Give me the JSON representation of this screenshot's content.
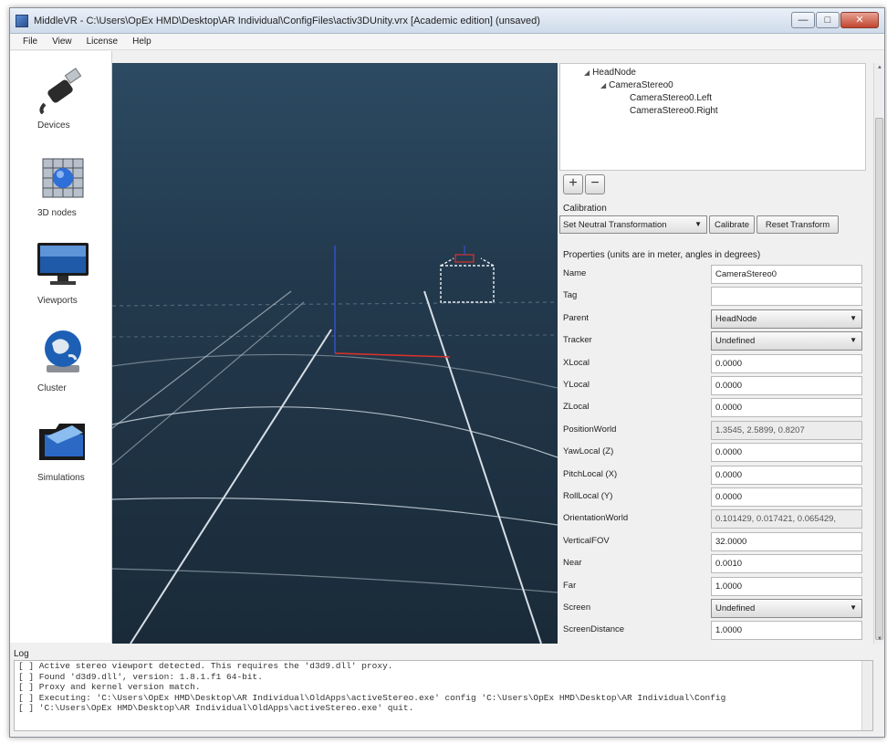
{
  "window": {
    "title": "MiddleVR - C:\\Users\\OpEx HMD\\Desktop\\AR Individual\\ConfigFiles\\activ3DUnity.vrx [Academic edition] (unsaved)",
    "minimize_glyph": "—",
    "maximize_glyph": "□",
    "close_glyph": "✕"
  },
  "menu": [
    "File",
    "View",
    "License",
    "Help"
  ],
  "sidebar": {
    "items": [
      {
        "label": "Devices",
        "icon": "usb-plug-icon"
      },
      {
        "label": "3D nodes",
        "icon": "cube-node-icon"
      },
      {
        "label": "Viewports",
        "icon": "monitor-icon"
      },
      {
        "label": "Cluster",
        "icon": "globe-icon"
      },
      {
        "label": "Simulations",
        "icon": "folder-icon"
      }
    ]
  },
  "tree": {
    "nodes": [
      {
        "label": "HeadNode",
        "expanded": true
      },
      {
        "label": "CameraStereo0",
        "expanded": true
      },
      {
        "label": "CameraStereo0.Left"
      },
      {
        "label": "CameraStereo0.Right"
      }
    ]
  },
  "buttons": {
    "add": "+",
    "remove": "−"
  },
  "calibration": {
    "label": "Calibration",
    "select_value": "Set Neutral Transformation",
    "calibrate_button": "Calibrate",
    "reset_button": "Reset Transform"
  },
  "properties": {
    "header": "Properties (units are in meter, angles in degrees)",
    "rows": [
      {
        "name": "Name",
        "value": "CameraStereo0",
        "kind": "text"
      },
      {
        "name": "Tag",
        "value": "",
        "kind": "text"
      },
      {
        "name": "Parent",
        "value": "HeadNode",
        "kind": "select"
      },
      {
        "name": "Tracker",
        "value": "Undefined",
        "kind": "select"
      },
      {
        "name": "XLocal",
        "value": "0.0000",
        "kind": "text"
      },
      {
        "name": "YLocal",
        "value": "0.0000",
        "kind": "text"
      },
      {
        "name": "ZLocal",
        "value": "0.0000",
        "kind": "text"
      },
      {
        "name": "PositionWorld",
        "value": "1.3545, 2.5899, 0.8207",
        "kind": "readonly"
      },
      {
        "name": "YawLocal (Z)",
        "value": "0.0000",
        "kind": "text"
      },
      {
        "name": "PitchLocal (X)",
        "value": "0.0000",
        "kind": "text"
      },
      {
        "name": "RollLocal (Y)",
        "value": "0.0000",
        "kind": "text"
      },
      {
        "name": "OrientationWorld",
        "value": "0.101429, 0.017421, 0.065429,",
        "kind": "readonly"
      },
      {
        "name": "VerticalFOV",
        "value": "32.0000",
        "kind": "text"
      },
      {
        "name": "Near",
        "value": "0.0010",
        "kind": "text"
      },
      {
        "name": "Far",
        "value": "1.0000",
        "kind": "text"
      },
      {
        "name": "Screen",
        "value": "Undefined",
        "kind": "select"
      },
      {
        "name": "ScreenDistance",
        "value": "1.0000",
        "kind": "text"
      }
    ]
  },
  "log": {
    "title": "Log",
    "lines": [
      "[ ] Active stereo viewport detected. This requires the 'd3d9.dll' proxy.",
      "[ ] Found 'd3d9.dll', version: 1.8.1.f1 64-bit.",
      "[ ] Proxy and kernel version match.",
      "[ ] Executing: 'C:\\Users\\OpEx HMD\\Desktop\\AR Individual\\OldApps\\activeStereo.exe'   config 'C:\\Users\\OpEx HMD\\Desktop\\AR Individual\\Config",
      "[ ] 'C:\\Users\\OpEx HMD\\Desktop\\AR Individual\\OldApps\\activeStereo.exe' quit."
    ]
  },
  "colors": {
    "viewport_top": "#2c4a62",
    "viewport_bottom": "#1a2a38",
    "grid": "#c9d3dc",
    "axis_x": "#d8322c",
    "axis_z": "#3550c8",
    "frustum": "#e9eef2"
  }
}
